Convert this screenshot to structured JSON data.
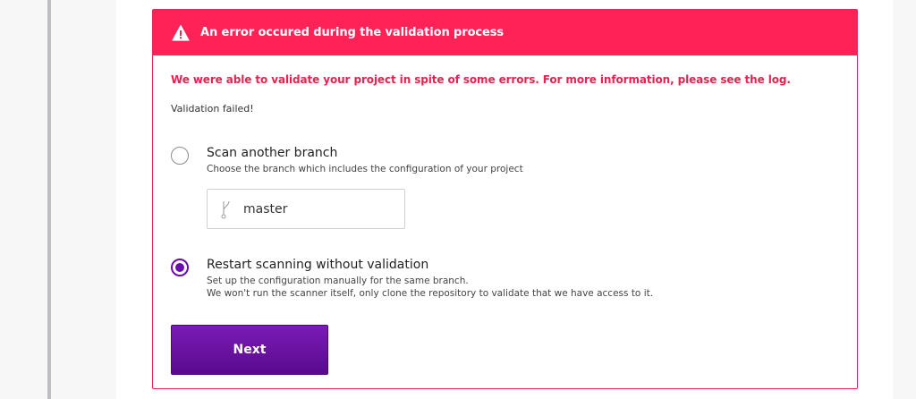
{
  "error": {
    "title": "An error occured during the validation process",
    "message": "We were able to validate your project in spite of some errors. For more information, please see the log.",
    "status": "Validation failed!"
  },
  "options": [
    {
      "title": "Scan another branch",
      "description": "Choose the branch which includes the configuration of your project",
      "selected": false,
      "branch": "master"
    },
    {
      "title": "Restart scanning without validation",
      "description_line1": "Set up the configuration manually for the same branch.",
      "description_line2": "We won't run the scanner itself, only clone the repository to validate that we have access to it.",
      "selected": true
    }
  ],
  "next_label": "Next",
  "colors": {
    "error_header": "#fe2256",
    "error_text": "#e52250",
    "accent": "#6a0dad"
  },
  "icons": {
    "header": "warning-icon",
    "branch": "git-branch-icon"
  }
}
